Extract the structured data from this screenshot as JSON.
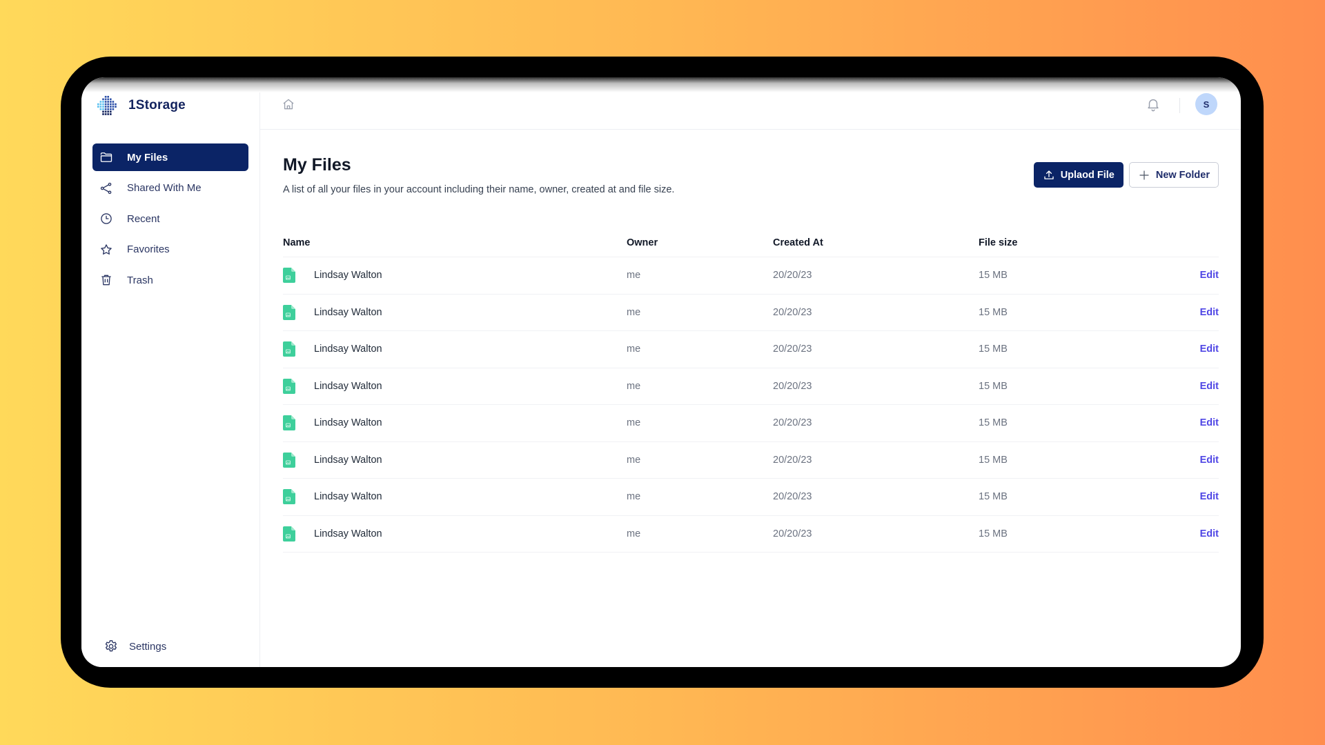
{
  "app": {
    "name": "1Storage",
    "brand_color": "#0B2466",
    "accent_link_color": "#4F46E5",
    "file_icon_color": "#3ECF9B"
  },
  "sidebar": {
    "items": [
      {
        "label": "My Files",
        "icon": "folder-icon",
        "active": true
      },
      {
        "label": "Shared With Me",
        "icon": "share-icon",
        "active": false
      },
      {
        "label": "Recent",
        "icon": "clock-icon",
        "active": false
      },
      {
        "label": "Favorites",
        "icon": "star-icon",
        "active": false
      },
      {
        "label": "Trash",
        "icon": "trash-icon",
        "active": false
      }
    ],
    "settings_label": "Settings"
  },
  "topbar": {
    "home_icon": "home-icon",
    "notifications_icon": "bell-icon",
    "avatar_initial": "S"
  },
  "main": {
    "title": "My Files",
    "description": "A list of all your files in your account including their name, owner, created at and file size.",
    "upload_label": "Uplaod File",
    "new_folder_label": "New Folder"
  },
  "table": {
    "columns": [
      "Name",
      "Owner",
      "Created At",
      "File size"
    ],
    "rows": [
      {
        "name": "Lindsay Walton",
        "owner": "me",
        "created": "20/20/23",
        "size": "15 MB",
        "action": "Edit"
      },
      {
        "name": "Lindsay Walton",
        "owner": "me",
        "created": "20/20/23",
        "size": "15 MB",
        "action": "Edit"
      },
      {
        "name": "Lindsay Walton",
        "owner": "me",
        "created": "20/20/23",
        "size": "15 MB",
        "action": "Edit"
      },
      {
        "name": "Lindsay Walton",
        "owner": "me",
        "created": "20/20/23",
        "size": "15 MB",
        "action": "Edit"
      },
      {
        "name": "Lindsay Walton",
        "owner": "me",
        "created": "20/20/23",
        "size": "15 MB",
        "action": "Edit"
      },
      {
        "name": "Lindsay Walton",
        "owner": "me",
        "created": "20/20/23",
        "size": "15 MB",
        "action": "Edit"
      },
      {
        "name": "Lindsay Walton",
        "owner": "me",
        "created": "20/20/23",
        "size": "15 MB",
        "action": "Edit"
      },
      {
        "name": "Lindsay Walton",
        "owner": "me",
        "created": "20/20/23",
        "size": "15 MB",
        "action": "Edit"
      }
    ]
  }
}
